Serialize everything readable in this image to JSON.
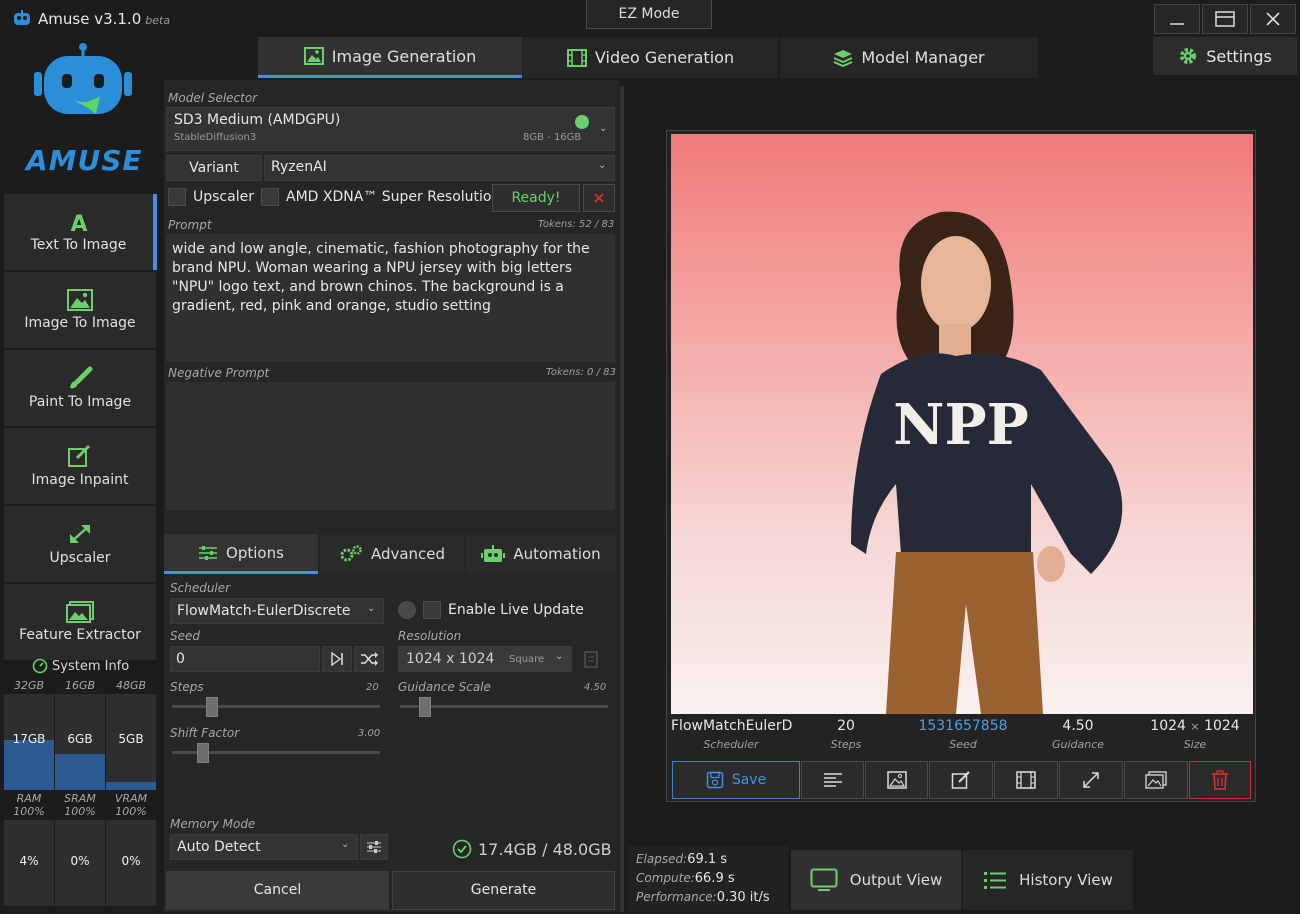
{
  "app": {
    "title": "Amuse v3.1.0",
    "beta": "beta",
    "logo_text": "AMUSE",
    "ez_mode": "EZ Mode"
  },
  "tabs": [
    {
      "label": "Image Generation"
    },
    {
      "label": "Video Generation"
    },
    {
      "label": "Model Manager"
    }
  ],
  "settings_label": "Settings",
  "sidebar": {
    "items": [
      {
        "label": "Text To Image"
      },
      {
        "label": "Image To Image"
      },
      {
        "label": "Paint To Image"
      },
      {
        "label": "Image Inpaint"
      },
      {
        "label": "Upscaler"
      },
      {
        "label": "Feature Extractor"
      }
    ],
    "system_info": "System Info",
    "meters": [
      {
        "cap": "32GB",
        "value": "17GB",
        "name": "RAM",
        "pct": "100%",
        "usage": "4%",
        "fill": 0.52
      },
      {
        "cap": "16GB",
        "value": "6GB",
        "name": "SRAM",
        "pct": "100%",
        "usage": "0%",
        "fill": 0.37
      },
      {
        "cap": "48GB",
        "value": "5GB",
        "name": "VRAM",
        "pct": "100%",
        "usage": "0%",
        "fill": 0.08
      }
    ]
  },
  "model": {
    "selector_label": "Model Selector",
    "name": "SD3 Medium (AMDGPU)",
    "type": "StableDiffusion3",
    "memory": "8GB - 16GB",
    "variant_label": "Variant",
    "variant": "RyzenAI",
    "upscaler_label": "Upscaler",
    "xdna_label": "AMD XDNA™ Super Resolution",
    "ready": "Ready!"
  },
  "prompt": {
    "label": "Prompt",
    "tokens": "Tokens: 52 / 83",
    "text": "wide and low angle, cinematic, fashion photography for the brand NPU. Woman wearing a NPU jersey with big letters \"NPU\" logo text, and brown chinos. The background is a gradient, red, pink and orange, studio setting",
    "negative_label": "Negative Prompt",
    "negative_tokens": "Tokens: 0 / 83",
    "negative_text": ""
  },
  "subtabs": [
    {
      "label": "Options"
    },
    {
      "label": "Advanced"
    },
    {
      "label": "Automation"
    }
  ],
  "options": {
    "scheduler_label": "Scheduler",
    "scheduler": "FlowMatch-EulerDiscrete",
    "live_update": "Enable Live Update",
    "seed_label": "Seed",
    "seed": "0",
    "resolution_label": "Resolution",
    "resolution": "1024 x 1024",
    "resolution_mode": "Square",
    "steps_label": "Steps",
    "steps": "20",
    "steps_fraction": 0.19,
    "guidance_label": "Guidance Scale",
    "guidance": "4.50",
    "guidance_fraction": 0.12,
    "shift_label": "Shift Factor",
    "shift": "3.00",
    "shift_fraction": 0.15,
    "memory_mode_label": "Memory Mode",
    "memory_mode": "Auto Detect",
    "memory_status": "17.4GB / 48.0GB",
    "cancel": "Cancel",
    "generate": "Generate"
  },
  "output": {
    "jersey_text": "NPP",
    "scheduler": "FlowMatchEulerD",
    "scheduler_lbl": "Scheduler",
    "steps": "20",
    "steps_lbl": "Steps",
    "seed": "1531657858",
    "seed_lbl": "Seed",
    "guidance": "4.50",
    "guidance_lbl": "Guidance",
    "size_w": "1024",
    "size_x": "×",
    "size_h": "1024",
    "size_lbl": "Size",
    "save": "Save"
  },
  "stats": {
    "elapsed_label": "Elapsed:",
    "elapsed": "69.1 s",
    "compute_label": "Compute:",
    "compute": "66.9 s",
    "perf_label": "Performance:",
    "perf": "0.30 it/s"
  },
  "views": {
    "output": "Output View",
    "history": "History View"
  },
  "colors": {
    "accent": "#4a90e2",
    "ready": "#6ccf6c",
    "danger": "#d93030",
    "seed": "#4aa3e8"
  }
}
